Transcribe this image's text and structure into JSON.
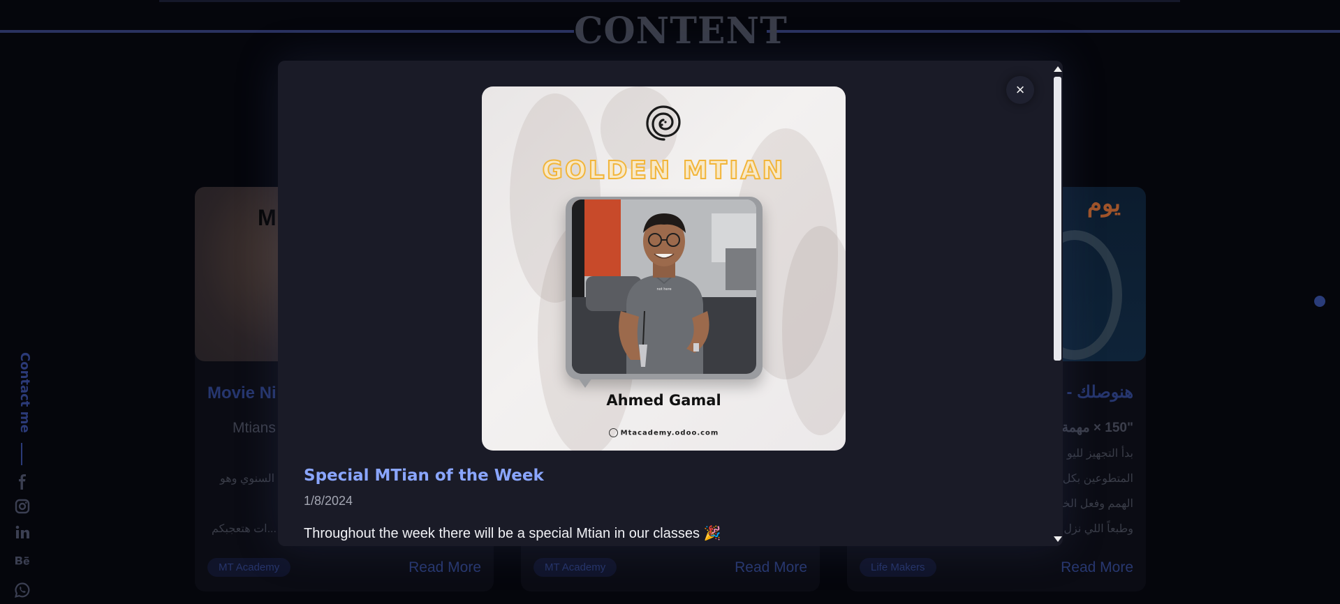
{
  "section": {
    "title": "CONTENT"
  },
  "contact": {
    "label": "Contact me"
  },
  "social_icons": [
    "facebook-icon",
    "instagram-icon",
    "linkedin-icon",
    "behance-icon",
    "whatsapp-icon"
  ],
  "cards": [
    {
      "title": "Movie Ni",
      "subtitle": "Mtians",
      "line1": "ة السنوي وهو",
      "line2": "ات هتعجبكم...",
      "tag": "MT Academy",
      "read_more": "Read More"
    },
    {
      "tag": "MT Academy",
      "read_more": "Read More"
    },
    {
      "title": "هنوصلك - ي",
      "line1": "\"150 × مهمة",
      "line2": "بدأ التجهيز لليو",
      "line3": "المتطوعين بكل",
      "line4": "الهمم وفعل الخير",
      "line5": "وطبعاً اللي نزل",
      "badge": "يوم",
      "tag": "Life Makers",
      "read_more": "Read More"
    }
  ],
  "modal": {
    "image": {
      "headline": "GOLDEN MTIAN",
      "person_name": "Ahmed Gamal",
      "website": "Mtacademy.odoo.com"
    },
    "close_label": "×",
    "post_title": "Special MTian of the Week",
    "post_date": "1/8/2024",
    "post_body": "Throughout the week there will be a special Mtian in our classes 🎉"
  },
  "colors": {
    "accent": "#8aa6ff",
    "golden": "#f2b53a",
    "modal_bg": "#1a1b27",
    "page_bg": "#05060c"
  }
}
